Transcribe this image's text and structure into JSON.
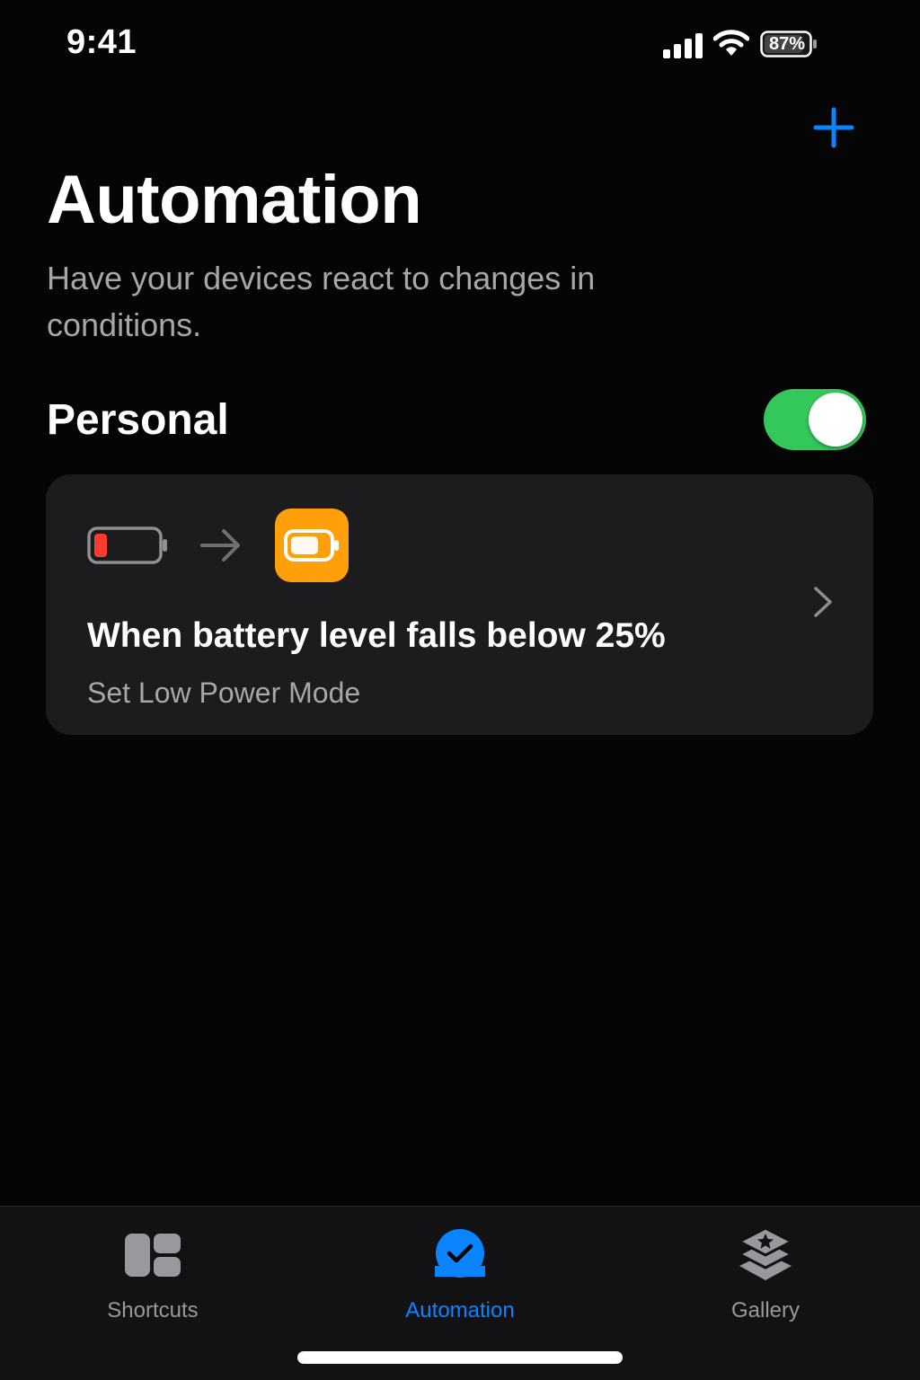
{
  "status_bar": {
    "time": "9:41",
    "battery_percent": "87%",
    "icons": [
      "signal-icon",
      "wifi-icon",
      "battery-icon"
    ]
  },
  "header": {
    "add_icon": "plus-icon",
    "title": "Automation",
    "subtitle": "Have your devices react to changes in conditions."
  },
  "section": {
    "title": "Personal",
    "toggle_on": true
  },
  "automation_card": {
    "title": "When battery level falls below 25%",
    "subtitle": "Set Low Power Mode",
    "icons": [
      "low-battery-icon",
      "arrow-right-icon",
      "low-power-mode-icon",
      "chevron-right-icon"
    ]
  },
  "tab_bar": {
    "tabs": [
      {
        "label": "Shortcuts",
        "icon": "shortcuts-grid-icon",
        "active": false
      },
      {
        "label": "Automation",
        "icon": "automation-check-icon",
        "active": true
      },
      {
        "label": "Gallery",
        "icon": "gallery-layers-icon",
        "active": false
      }
    ]
  },
  "colors": {
    "accent": "#0a84ff",
    "toggle_on": "#34c759",
    "power_mode": "#ff9f0a",
    "low_battery": "#ff3b30",
    "card_bg": "#1c1c1e",
    "secondary_text": "#a6a6ab"
  }
}
